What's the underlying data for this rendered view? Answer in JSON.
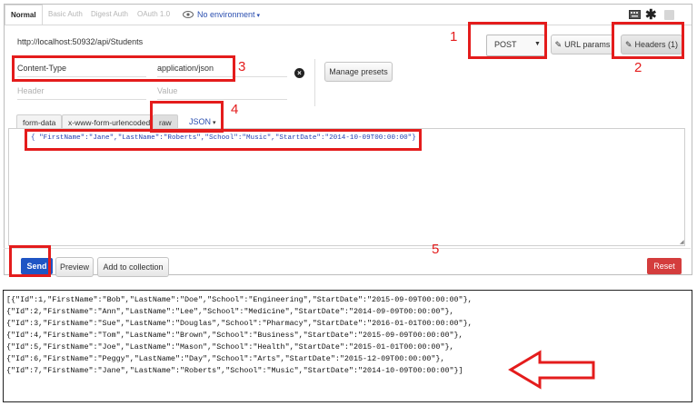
{
  "auth_tabs": [
    "Normal",
    "Basic Auth",
    "Digest Auth",
    "OAuth 1.0"
  ],
  "environment": "No environment",
  "request": {
    "url": "http://localhost:50932/api/Students",
    "method": "POST",
    "url_params_label": "URL params",
    "headers_label": "Headers (1)"
  },
  "headers": {
    "rows": [
      {
        "key": "Content-Type",
        "value": "application/json"
      }
    ],
    "key_placeholder": "Header",
    "value_placeholder": "Value",
    "manage_presets": "Manage presets"
  },
  "body_tabs": [
    "form-data",
    "x-www-form-urlencoded",
    "raw"
  ],
  "body_format": "JSON",
  "body_text": "{ \"FirstName\":\"Jane\",\"LastName\":\"Roberts\",\"School\":\"Music\",\"StartDate\":\"2014-10-09T00:00:00\"}",
  "buttons": {
    "send": "Send",
    "preview": "Preview",
    "add_to_collection": "Add to collection",
    "reset": "Reset"
  },
  "annotations": [
    "1",
    "2",
    "3",
    "4",
    "5"
  ],
  "annotation_color": "#e41c1c",
  "response_lines": [
    "[{\"Id\":1,\"FirstName\":\"Bob\",\"LastName\":\"Doe\",\"School\":\"Engineering\",\"StartDate\":\"2015-09-09T00:00:00\"},",
    "{\"Id\":2,\"FirstName\":\"Ann\",\"LastName\":\"Lee\",\"School\":\"Medicine\",\"StartDate\":\"2014-09-09T00:00:00\"},",
    "{\"Id\":3,\"FirstName\":\"Sue\",\"LastName\":\"Douglas\",\"School\":\"Pharmacy\",\"StartDate\":\"2016-01-01T00:00:00\"},",
    "{\"Id\":4,\"FirstName\":\"Tom\",\"LastName\":\"Brown\",\"School\":\"Business\",\"StartDate\":\"2015-09-09T00:00:00\"},",
    "{\"Id\":5,\"FirstName\":\"Joe\",\"LastName\":\"Mason\",\"School\":\"Health\",\"StartDate\":\"2015-01-01T00:00:00\"},",
    "{\"Id\":6,\"FirstName\":\"Peggy\",\"LastName\":\"Day\",\"School\":\"Arts\",\"StartDate\":\"2015-12-09T00:00:00\"},",
    "{\"Id\":7,\"FirstName\":\"Jane\",\"LastName\":\"Roberts\",\"School\":\"Music\",\"StartDate\":\"2014-10-09T00:00:00\"}]"
  ]
}
